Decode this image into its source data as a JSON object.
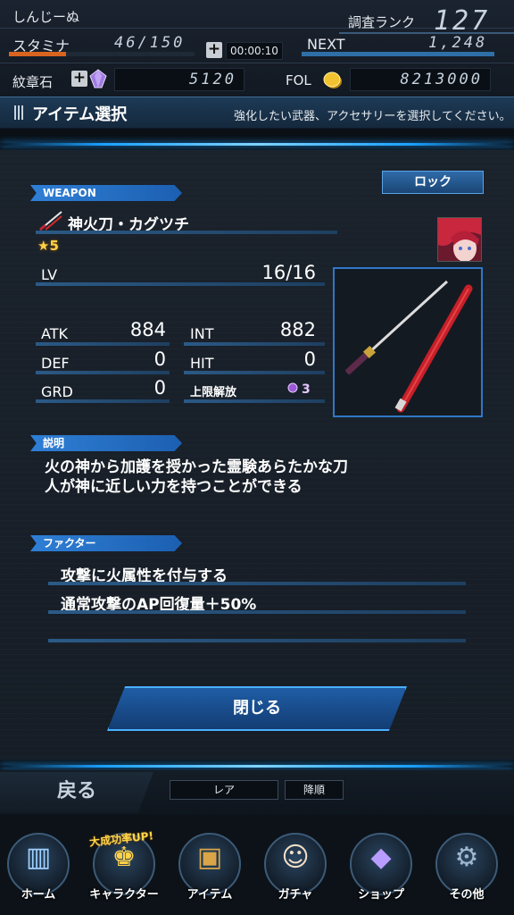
{
  "status": {
    "player_name": "しんじーぬ",
    "rank_label": "調査ランク",
    "rank_value": "127",
    "stamina_label": "スタミナ",
    "stamina_value": "46/150",
    "stamina_fraction": 0.31,
    "plus": "+",
    "timer": "00:00:10",
    "next_label": "NEXT",
    "next_value": "1,248",
    "crest_label": "紋章石",
    "crest_value": "5120",
    "fol_label": "FOL",
    "fol_value": "8213000"
  },
  "header": {
    "title": "アイテム選択",
    "hint": "強化したい武器、アクセサリーを選択してください。"
  },
  "item": {
    "category_tag": "WEAPON",
    "lock_label": "ロック",
    "name": "神火刀・カグツチ",
    "rarity": "★5",
    "lv_label": "LV",
    "lv_value": "16/16",
    "stats": {
      "atk_label": "ATK",
      "atk": "884",
      "int_label": "INT",
      "int": "882",
      "def_label": "DEF",
      "def": "0",
      "hit_label": "HIT",
      "hit": "0",
      "grd_label": "GRD",
      "grd": "0",
      "limit_label": "上限解放",
      "limit": "3"
    },
    "desc_tag": "説明",
    "desc_line1": "火の神から加護を授かった霊験あらたかな刀",
    "desc_line2": "人が神に近しい力を持つことができる",
    "factor_tag": "ファクター",
    "factor_1": "攻撃に火属性を付与する",
    "factor_2": "通常攻撃のAP回復量＋50%"
  },
  "close_label": "閉じる",
  "footer": {
    "back_label": "戻る",
    "sort_rarity": "レア",
    "sort_order": "降順",
    "banner": "大成功率UP!",
    "nav": [
      {
        "label": "ホーム",
        "icon": "home-icon"
      },
      {
        "label": "キャラクター",
        "icon": "character-icon"
      },
      {
        "label": "アイテム",
        "icon": "item-icon"
      },
      {
        "label": "ガチャ",
        "icon": "gacha-icon"
      },
      {
        "label": "ショップ",
        "icon": "shop-icon"
      },
      {
        "label": "その他",
        "icon": "gear-icon"
      }
    ]
  },
  "colors": {
    "accent": "#1aa0ff",
    "stamina": "#d9641f",
    "rarity": "#ffd24a"
  }
}
